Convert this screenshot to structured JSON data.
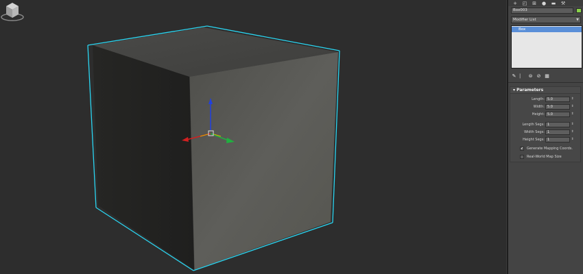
{
  "command_panel": {
    "tabs": [
      {
        "icon": "create-icon",
        "glyph": "+"
      },
      {
        "icon": "modify-icon",
        "glyph": "◰"
      },
      {
        "icon": "hierarchy-icon",
        "glyph": "⊞"
      },
      {
        "icon": "motion-icon",
        "glyph": "●"
      },
      {
        "icon": "display-icon",
        "glyph": "▬"
      },
      {
        "icon": "utilities-icon",
        "glyph": "⚒"
      }
    ],
    "object_name": "Box003",
    "object_color": "#8ad24a",
    "modifier_list_label": "Modifier List",
    "stack": [
      {
        "label": "Box"
      }
    ],
    "stack_tools": [
      {
        "icon": "pin-stack-icon",
        "glyph": "✎"
      },
      {
        "icon": "show-end-result-icon",
        "glyph": "⎸"
      },
      {
        "icon": "make-unique-icon",
        "glyph": "⊜"
      },
      {
        "icon": "remove-modifier-icon",
        "glyph": "⊘"
      },
      {
        "icon": "configure-modifier-sets-icon",
        "glyph": "▦"
      }
    ],
    "parameters": {
      "title": "Parameters",
      "length_label": "Length:",
      "length_value": "5.0",
      "width_label": "Width:",
      "width_value": "5.0",
      "height_label": "Height:",
      "height_value": "5.0",
      "length_segs_label": "Length Segs:",
      "length_segs_value": "1",
      "width_segs_label": "Width Segs:",
      "width_segs_value": "1",
      "height_segs_label": "Height Segs:",
      "height_segs_value": "1",
      "generate_mapping_label": "Generate Mapping Coords.",
      "generate_mapping_checked": true,
      "real_world_label": "Real-World Map Size",
      "real_world_checked": false
    }
  },
  "viewport": {
    "selection_color": "#2ad6f2",
    "axis_colors": {
      "x": "#d22020",
      "y": "#20b040",
      "z": "#2040e0"
    }
  }
}
